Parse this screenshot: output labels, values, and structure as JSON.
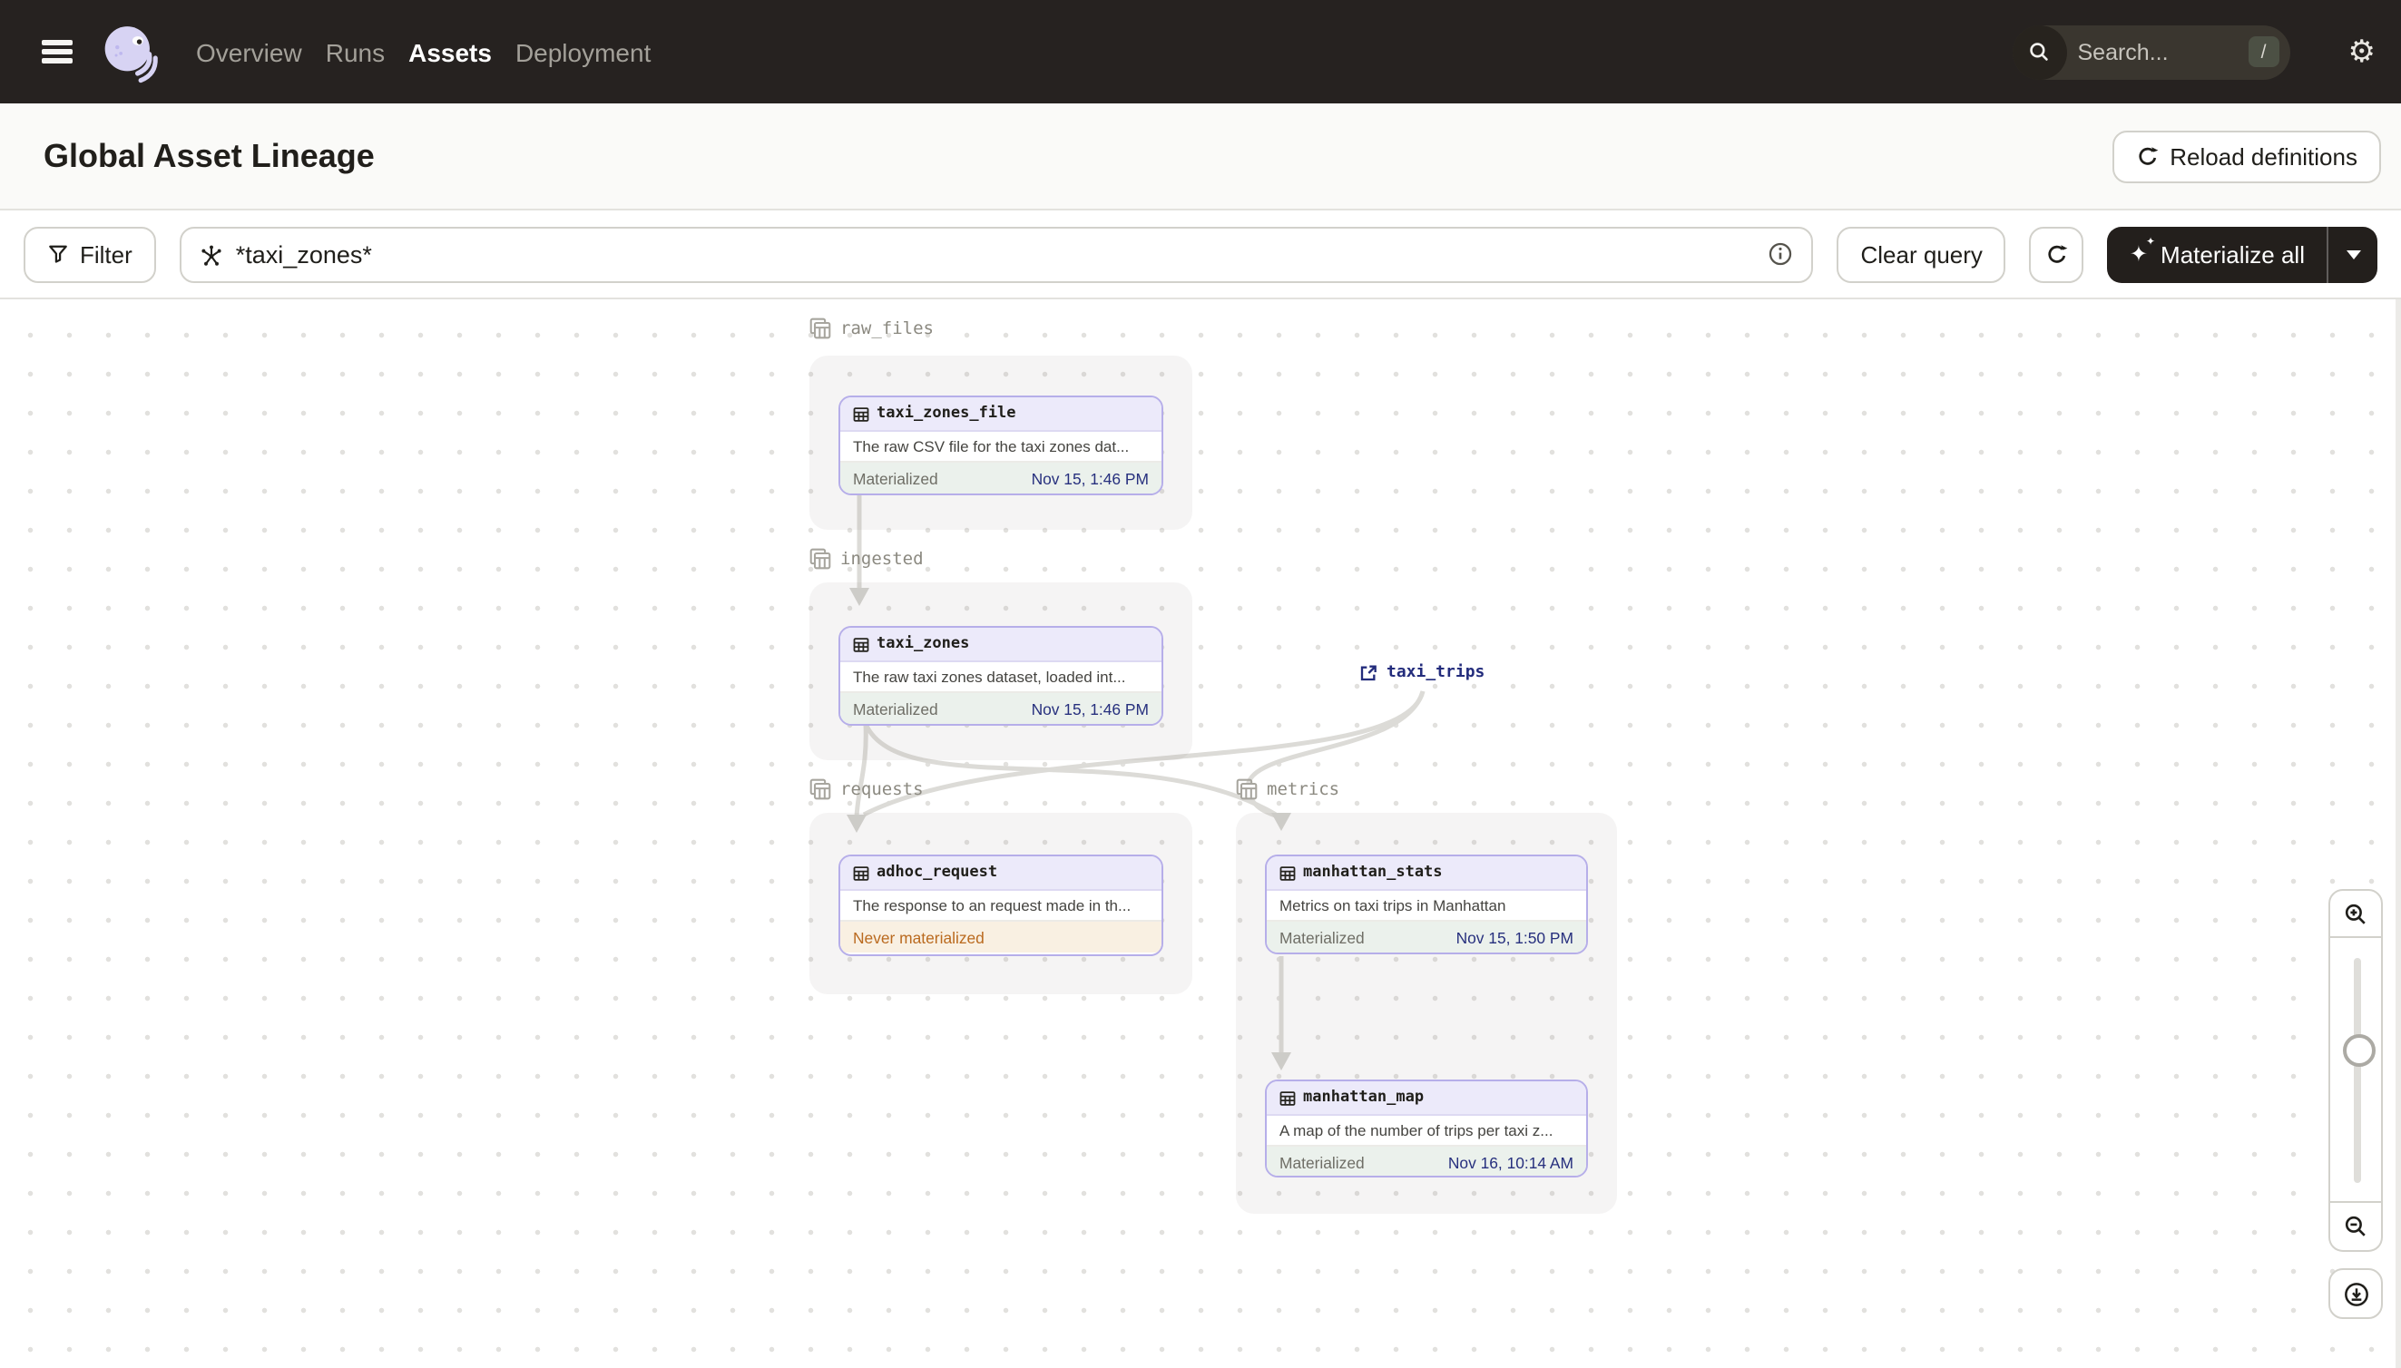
{
  "navbar": {
    "items": [
      {
        "label": "Overview",
        "active": false
      },
      {
        "label": "Runs",
        "active": false
      },
      {
        "label": "Assets",
        "active": true
      },
      {
        "label": "Deployment",
        "active": false
      }
    ],
    "search_placeholder": "Search...",
    "search_shortcut": "/"
  },
  "header": {
    "title": "Global Asset Lineage",
    "reload_button": "Reload definitions"
  },
  "toolbar": {
    "filter_label": "Filter",
    "query_value": "*taxi_zones*",
    "clear_label": "Clear query",
    "materialize_label": "Materialize all"
  },
  "graph": {
    "groups": [
      {
        "name": "raw_files",
        "nodes": [
          {
            "name": "taxi_zones_file",
            "description": "The raw CSV file for the taxi zones dat...",
            "status": "Materialized",
            "timestamp": "Nov 15, 1:46 PM",
            "state": "materialized"
          }
        ]
      },
      {
        "name": "ingested",
        "nodes": [
          {
            "name": "taxi_zones",
            "description": "The raw taxi zones dataset, loaded int...",
            "status": "Materialized",
            "timestamp": "Nov 15, 1:46 PM",
            "state": "materialized"
          }
        ]
      },
      {
        "name": "requests",
        "nodes": [
          {
            "name": "adhoc_request",
            "description": "The response to an request made in th...",
            "status": "Never materialized",
            "timestamp": "",
            "state": "never_materialized"
          }
        ]
      },
      {
        "name": "metrics",
        "nodes": [
          {
            "name": "manhattan_stats",
            "description": "Metrics on taxi trips in Manhattan",
            "status": "Materialized",
            "timestamp": "Nov 15, 1:50 PM",
            "state": "materialized"
          },
          {
            "name": "manhattan_map",
            "description": "A map of the number of trips per taxi z...",
            "status": "Materialized",
            "timestamp": "Nov 16, 10:14 AM",
            "state": "materialized"
          }
        ]
      }
    ],
    "external_assets": [
      {
        "name": "taxi_trips"
      }
    ],
    "edges": [
      {
        "from": "taxi_zones_file",
        "to": "taxi_zones"
      },
      {
        "from": "taxi_zones",
        "to": "adhoc_request"
      },
      {
        "from": "taxi_zones",
        "to": "manhattan_stats"
      },
      {
        "from": "taxi_trips",
        "to": "adhoc_request"
      },
      {
        "from": "taxi_trips",
        "to": "manhattan_stats"
      },
      {
        "from": "manhattan_stats",
        "to": "manhattan_map"
      }
    ]
  },
  "colors": {
    "navbar_bg": "#262220",
    "node_border": "#B6AEE9",
    "node_header_bg": "#ECEAFA",
    "materialized_bg": "#EBF1EC",
    "never_materialized_bg": "#F9F0E2",
    "never_materialized_text": "#BA6A1F",
    "timestamp_text": "#27307E",
    "external_asset_text": "#232C7C",
    "edge": "#DCDBD7",
    "materialize_button_bg": "#231F1C"
  }
}
